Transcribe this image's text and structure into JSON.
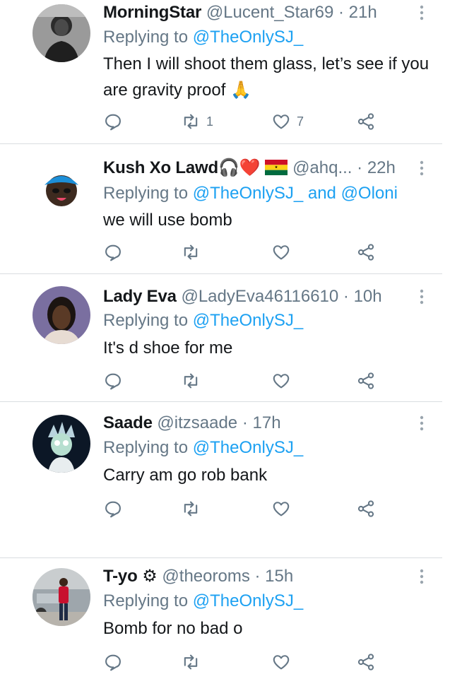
{
  "tweets": [
    {
      "name": "MorningStar",
      "handle": "@Lucent_Star69",
      "time": "21h",
      "reply_prefix": "Replying to",
      "mentions": [
        "@TheOnlySJ_"
      ],
      "mention_joiner": "",
      "text": "Then I will shoot them glass, let’s see if you are gravity proof 🙏",
      "retweets": "1",
      "likes": "7",
      "avatar": "woman-portrait-icon"
    },
    {
      "name": "Kush Xo Lawd",
      "name_emoji": "🎧❤️",
      "handle": "@ahq...",
      "time": "22h",
      "reply_prefix": "Replying to",
      "mentions": [
        "@TheOnlySJ_",
        "@Oloni"
      ],
      "mention_joiner": "and",
      "text": "we will use bomb",
      "retweets": "",
      "likes": "",
      "avatar": "cartoon-bandana-icon"
    },
    {
      "name": "Lady Eva",
      "handle": "@LadyEva46116610",
      "time": "10h",
      "reply_prefix": "Replying to",
      "mentions": [
        "@TheOnlySJ_"
      ],
      "mention_joiner": "",
      "text": "It's d shoe for me",
      "retweets": "",
      "likes": "",
      "avatar": "woman-portrait-icon"
    },
    {
      "name": "Saade",
      "handle": "@itzsaade",
      "time": "17h",
      "reply_prefix": "Replying to",
      "mentions": [
        "@TheOnlySJ_"
      ],
      "mention_joiner": "",
      "text": "Carry am go rob bank",
      "retweets": "",
      "likes": "",
      "avatar": "cartoon-scientist-icon"
    },
    {
      "name": "T-yo",
      "name_emoji": "⚙",
      "handle": "@theoroms",
      "time": "15h",
      "reply_prefix": "Replying to",
      "mentions": [
        "@TheOnlySJ_"
      ],
      "mention_joiner": "",
      "text": "Bomb for no bad o",
      "retweets": "",
      "likes": "",
      "avatar": "man-by-car-icon"
    }
  ],
  "separator_dot": "·",
  "colors": {
    "text": "#14171a",
    "secondary": "#657786",
    "link": "#1da1f2",
    "divider": "#d9dde0"
  }
}
